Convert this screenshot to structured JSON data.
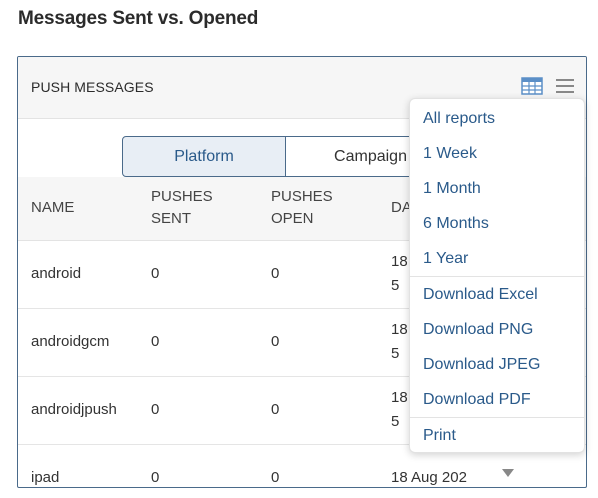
{
  "page": {
    "title": "Messages Sent vs. Opened"
  },
  "panel": {
    "title": "PUSH MESSAGES",
    "table_icon": "table-view-icon",
    "menu_icon": "hamburger-menu-icon"
  },
  "tabs": [
    {
      "label": "Platform",
      "active": true
    },
    {
      "label": "Campaign",
      "active": false
    }
  ],
  "table": {
    "headers": {
      "name": "NAME",
      "sent_line1": "PUSHES",
      "sent_line2": "SENT",
      "open_line1": "PUSHES",
      "open_line2": "OPEN",
      "date": "DA"
    },
    "rows": [
      {
        "name": "android",
        "sent": "0",
        "open": "0",
        "date1": "18",
        "date2": "5"
      },
      {
        "name": "androidgcm",
        "sent": "0",
        "open": "0",
        "date1": "18",
        "date2": "5"
      },
      {
        "name": "androidjpush",
        "sent": "0",
        "open": "0",
        "date1": "18",
        "date2": "5"
      },
      {
        "name": "ipad",
        "sent": "0",
        "open": "0",
        "date1": "18 Aug 202",
        "date2": ""
      }
    ]
  },
  "dropdown": {
    "group1": [
      "All reports",
      "1 Week",
      "1 Month",
      "6 Months",
      "1 Year"
    ],
    "group2": [
      "Download Excel",
      "Download PNG",
      "Download JPEG",
      "Download PDF"
    ],
    "group3": [
      "Print"
    ]
  },
  "colors": {
    "accent": "#2a5a8a",
    "border": "#4a6a8a",
    "header_bg": "#f6f6f6",
    "tab_active_bg": "#e8eef5",
    "icon_blue": "#5b8fc7",
    "icon_gray": "#888888"
  }
}
